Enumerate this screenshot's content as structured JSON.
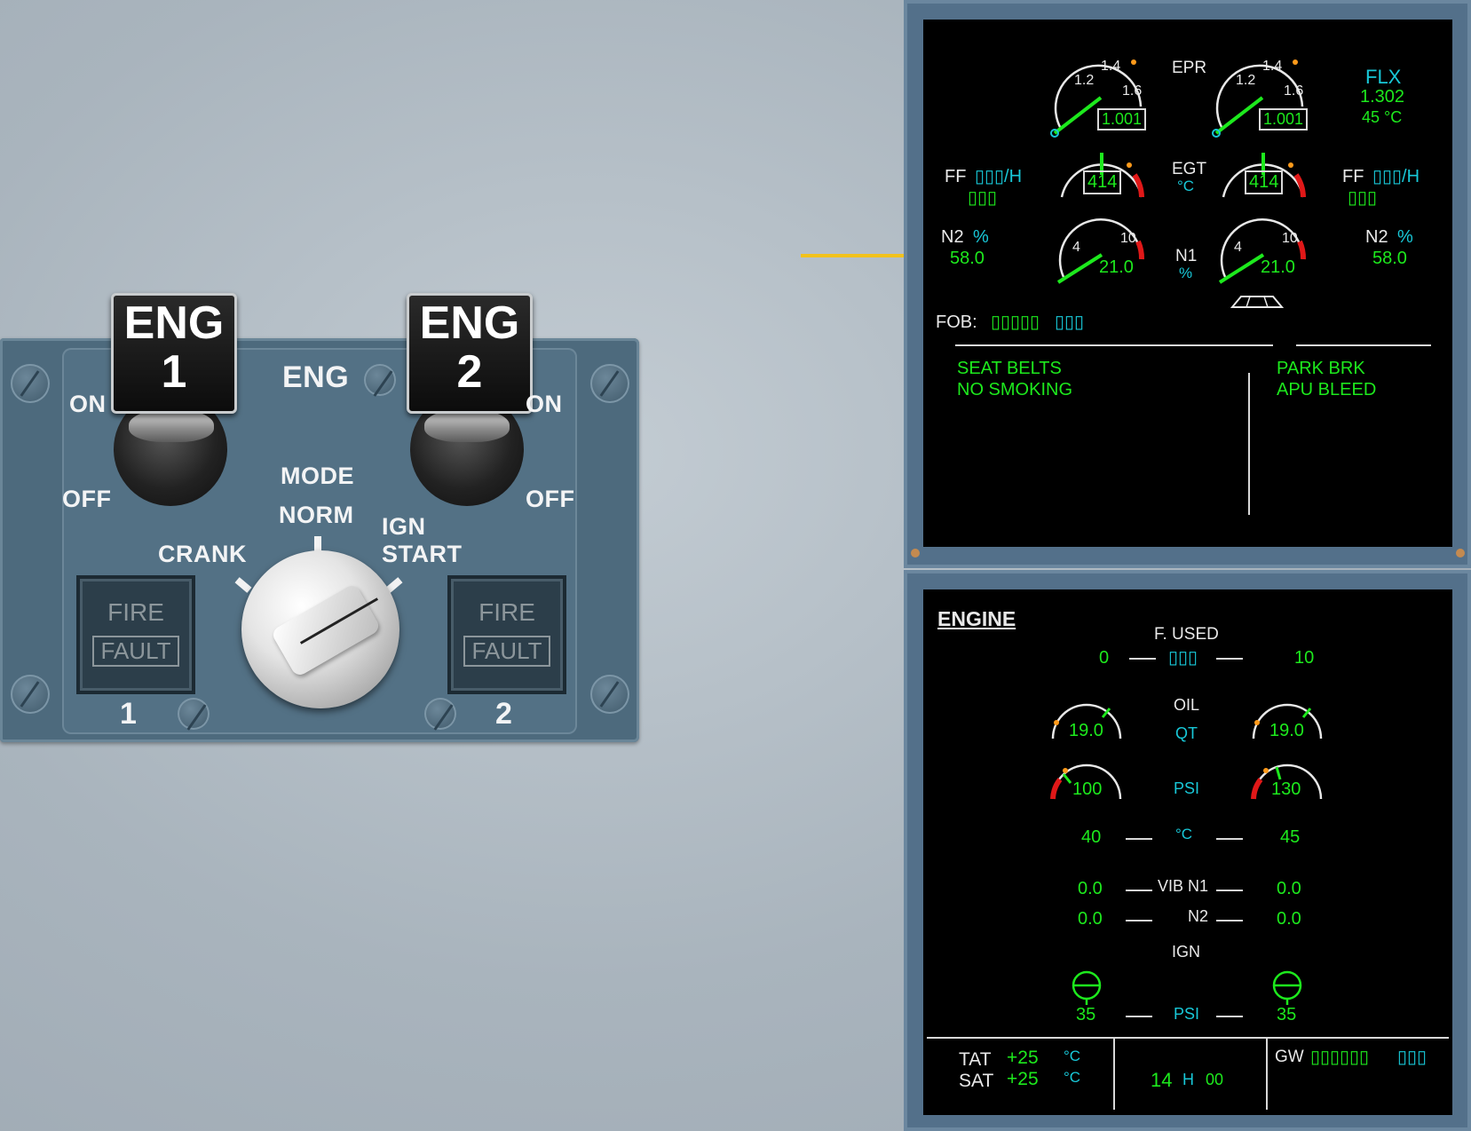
{
  "overhead": {
    "eng1_cap_top": "ENG",
    "eng1_cap_num": "1",
    "eng2_cap_top": "ENG",
    "eng2_cap_num": "2",
    "on_left": "ON",
    "on_right": "ON",
    "off_left": "OFF",
    "off_right": "OFF",
    "panel_title": "ENG",
    "mode_label": "MODE",
    "norm_label": "NORM",
    "crank_label": "CRANK",
    "ign_start_line1": "IGN",
    "ign_start_line2": "START",
    "fire_label": "FIRE",
    "fault_label": "FAULT",
    "fire1_num": "1",
    "fire2_num": "2"
  },
  "upper_ecam": {
    "epr_label": "EPR",
    "egt_label": "EGT",
    "egt_unit": "°C",
    "n1_label": "N1",
    "n1_unit": "%",
    "epr_scale": [
      "1.2",
      "1.4",
      "1.6"
    ],
    "epr_left_value": "1.001",
    "epr_right_value": "1.001",
    "egt_left_value": "414",
    "egt_right_value": "414",
    "n1_scale": [
      "4",
      "10"
    ],
    "n1_left_value": "21.0",
    "n1_right_value": "21.0",
    "flx_label": "FLX",
    "flx_value": "1.302",
    "flx_temp": "45 °C",
    "ff_label": "FF",
    "ff_left_unit": "▯▯▯/H",
    "ff_left_value": "▯▯▯",
    "ff_right_unit": "▯▯▯/H",
    "ff_right_value": "▯▯▯",
    "n2_label": "N2",
    "n2_unit": "%",
    "n2_left_value": "58.0",
    "n2_right_value": "58.0",
    "fob_label": "FOB:",
    "fob_value": "▯▯▯▯▯",
    "fob_unit": "▯▯▯",
    "memo_left": [
      "SEAT BELTS",
      "NO SMOKING"
    ],
    "memo_right": [
      "PARK BRK",
      "APU BLEED"
    ]
  },
  "lower_ecam": {
    "page_title": "ENGINE",
    "fused_label": "F. USED",
    "fused_left": "0",
    "fused_unit": "▯▯▯",
    "fused_right": "10",
    "oil_label": "OIL",
    "qt_label": "QT",
    "oil_qt_left": "19.0",
    "oil_qt_right": "19.0",
    "psi_label": "PSI",
    "oil_psi_left": "100",
    "oil_psi_right": "130",
    "temp_unit": "°C",
    "oil_temp_left": "40",
    "oil_temp_right": "45",
    "vib_n1_label": "VIB N1",
    "vib_n1_left": "0.0",
    "vib_n1_right": "0.0",
    "vib_n2_label": "N2",
    "vib_n2_left": "0.0",
    "vib_n2_right": "0.0",
    "ign_label": "IGN",
    "ign_psi_label": "PSI",
    "ign_psi_left": "35",
    "ign_psi_right": "35",
    "tat_label": "TAT",
    "tat_value": "+25",
    "tat_unit": "°C",
    "sat_label": "SAT",
    "sat_value": "+25",
    "sat_unit": "°C",
    "time_h": "14",
    "time_h_label": "H",
    "time_m": "00",
    "gw_label": "GW",
    "gw_value": "▯▯▯▯▯▯",
    "gw_unit": "▯▯▯"
  },
  "colors": {
    "green": "#1de91d",
    "cyan": "#18c8d8",
    "amber": "#ff9a1a",
    "red": "#e01818",
    "arrow_yellow": "#f2c21b"
  }
}
